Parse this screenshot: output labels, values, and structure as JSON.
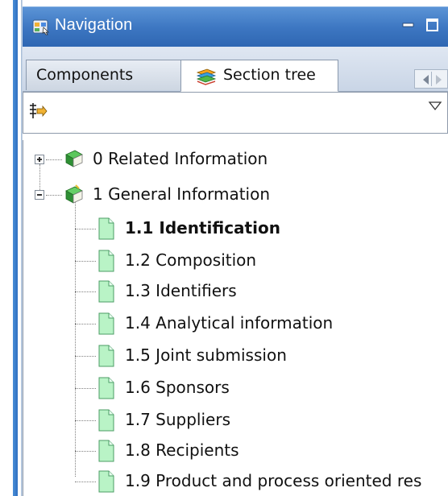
{
  "window": {
    "title": "Navigation",
    "icon": "navigation-icon",
    "minimize_icon": "minimize-icon",
    "maximize_icon": "maximize-icon"
  },
  "tabs": [
    {
      "label": "Components",
      "active": false
    },
    {
      "label": "Section tree",
      "active": true,
      "icon": "books-icon"
    }
  ],
  "toolbar": {
    "filter_icon": "filter-icon",
    "menu_icon": "view-menu-icon"
  },
  "tree": {
    "nodes": [
      {
        "label": "0 Related Information",
        "expanded": false,
        "icon": "book-icon"
      },
      {
        "label": "1 General Information",
        "expanded": true,
        "icon": "book-icon",
        "children": [
          {
            "label": "1.1 Identification",
            "selected_bold": true,
            "icon": "page-icon"
          },
          {
            "label": "1.2 Composition",
            "icon": "page-icon"
          },
          {
            "label": "1.3 Identifiers",
            "icon": "page-icon"
          },
          {
            "label": "1.4 Analytical information",
            "icon": "page-icon"
          },
          {
            "label": "1.5 Joint submission",
            "icon": "page-icon"
          },
          {
            "label": "1.6 Sponsors",
            "icon": "page-icon"
          },
          {
            "label": "1.7 Suppliers",
            "icon": "page-icon"
          },
          {
            "label": "1.8 Recipients",
            "icon": "page-icon"
          },
          {
            "label": "1.9 Product and process oriented res",
            "icon": "page-icon"
          }
        ]
      }
    ]
  },
  "colors": {
    "title_bar": "#3d77c2",
    "tab_bg": "#d3dcea",
    "book_green": "#2f9a3a",
    "page_green": "#b7f0c4"
  }
}
